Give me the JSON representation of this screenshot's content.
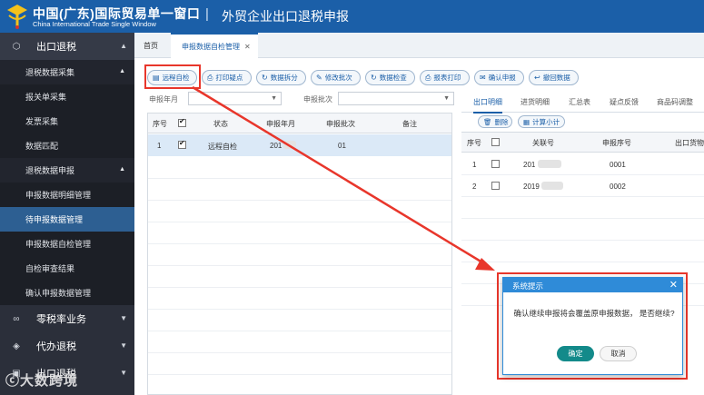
{
  "header": {
    "title_cn": "中国(广东)国际贸易单一窗口",
    "title_en": "China International Trade Single Window",
    "separator": "|",
    "subtitle": "外贸企业出口退税申报"
  },
  "sidebar": {
    "main1": "出口退税",
    "sub1": "退税数据采集",
    "items1": [
      "报关单采集",
      "发票采集",
      "数据匹配"
    ],
    "sub2": "退税数据申报",
    "items2": [
      "申报数据明细管理",
      "待申报数据管理",
      "申报数据自检管理",
      "自检审查结果",
      "确认申报数据管理"
    ],
    "main2": "零税率业务",
    "main3": "代办退税",
    "main4": "出口退税",
    "watermark": "大数跨境"
  },
  "tabs": {
    "home": "首页",
    "active": "申报数据自检管理",
    "close": "✕"
  },
  "toolbar": {
    "buttons": [
      {
        "label": "远程自检",
        "icon": "▤"
      },
      {
        "label": "打印疑点",
        "icon": "⎙"
      },
      {
        "label": "数据拆分",
        "icon": "↻"
      },
      {
        "label": "修改批次",
        "icon": "✎"
      },
      {
        "label": "数据检查",
        "icon": "↻"
      },
      {
        "label": "报表打印",
        "icon": "⎙"
      },
      {
        "label": "确认申报",
        "icon": "✉"
      },
      {
        "label": "撤回数据",
        "icon": "↩"
      }
    ]
  },
  "filters": {
    "label1": "申报年月",
    "label2": "申报批次"
  },
  "left_grid": {
    "headers": [
      "序号",
      "状态",
      "申报年月",
      "申报批次",
      "备注"
    ],
    "rows": [
      {
        "index": "1",
        "status": "远程自检",
        "month": "201",
        "batch": "01"
      }
    ]
  },
  "right_tabs": [
    "出口明细",
    "进货明细",
    "汇总表",
    "疑点反馈",
    "商品码调整"
  ],
  "right_buttons": {
    "delete": "删除",
    "subtotal": "计算小计"
  },
  "right_grid": {
    "headers": [
      "序号",
      "关联号",
      "申报序号",
      "出口货物"
    ],
    "rows": [
      {
        "index": "1",
        "link": "201",
        "seq": "0001"
      },
      {
        "index": "2",
        "link": "2019",
        "seq": "0002"
      }
    ]
  },
  "dialog": {
    "title": "系统提示",
    "close": "✕",
    "message": "确认继续申报将会覆盖原申报数据， 是否继续?",
    "ok": "确定",
    "cancel": "取消"
  },
  "colors": {
    "header_bg": "#1b5fa8",
    "sidebar_bg": "#2b2f3a",
    "active_nav": "#2d5f92",
    "annotation": "#e8362b",
    "dialog_head": "#2f8bd8",
    "ok_button": "#138a8a"
  }
}
